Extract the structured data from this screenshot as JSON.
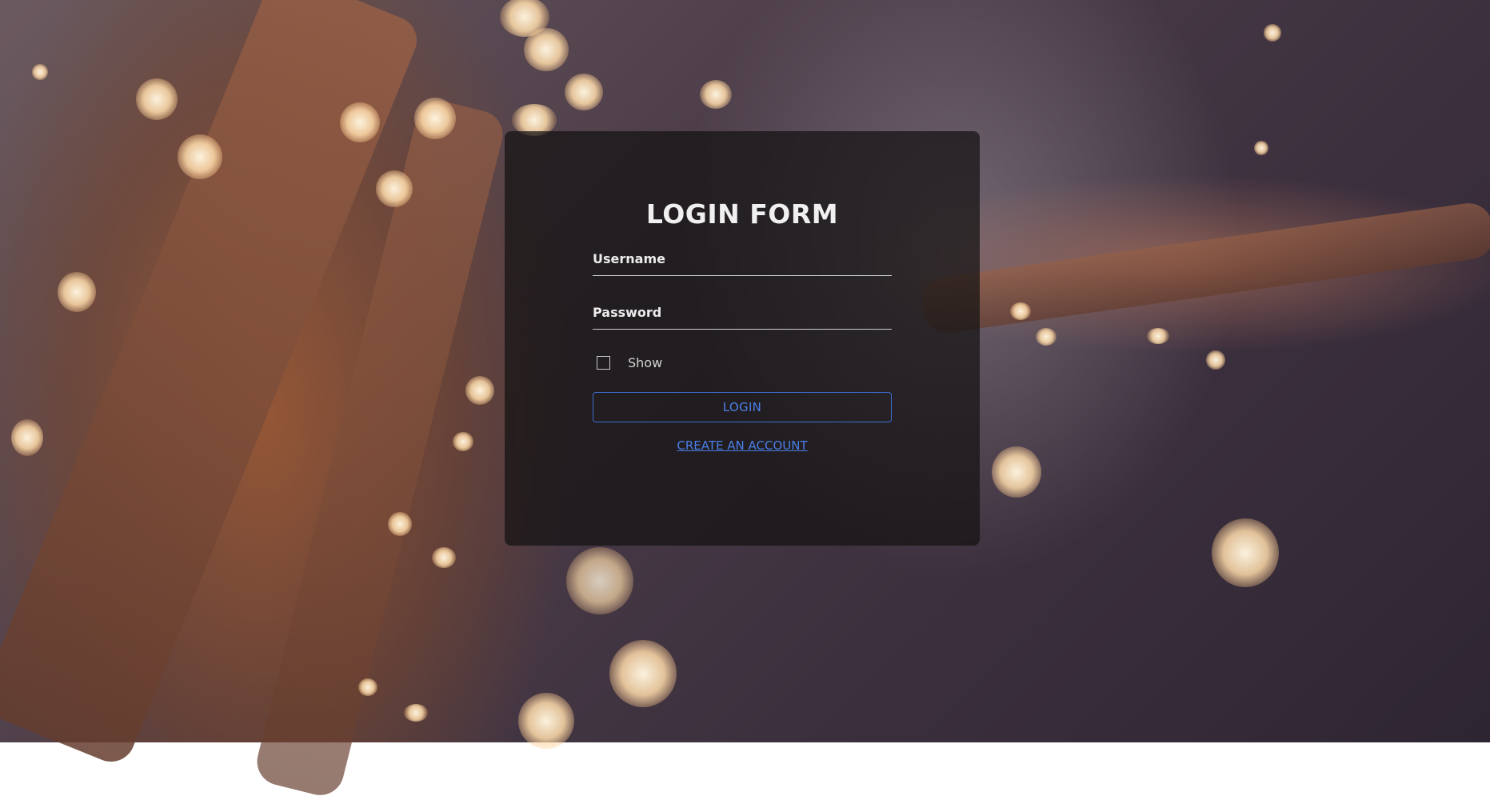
{
  "login_form": {
    "title": "LOGIN FORM",
    "username_label": "Username",
    "password_label": "Password",
    "show_label": "Show",
    "show_checked": false,
    "login_button": "LOGIN",
    "create_account_link": "CREATE AN ACCOUNT"
  },
  "colors": {
    "accent": "#3d6fd3",
    "card_background": "rgba(20,18,18,0.72)",
    "text": "#f0f0f0"
  }
}
